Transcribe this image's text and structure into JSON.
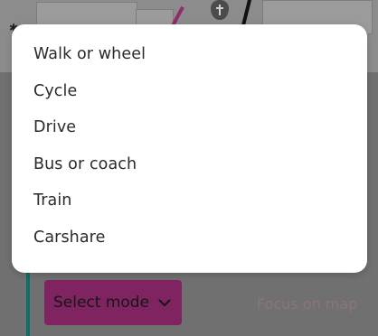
{
  "transport_menu": {
    "options": [
      "Walk or wheel",
      "Cycle",
      "Drive",
      "Bus or coach",
      "Train",
      "Carshare"
    ]
  },
  "controls": {
    "select_mode_label": "Select mode",
    "focus_on_map_label": "Focus on map"
  },
  "icons": {
    "map_pin": "place-of-worship-pin-icon",
    "dropdown": "chevron-down-icon"
  },
  "colors": {
    "select_mode_background": "#7f2461",
    "route_line": "#0a6f64",
    "menu_background": "#ffffff"
  }
}
